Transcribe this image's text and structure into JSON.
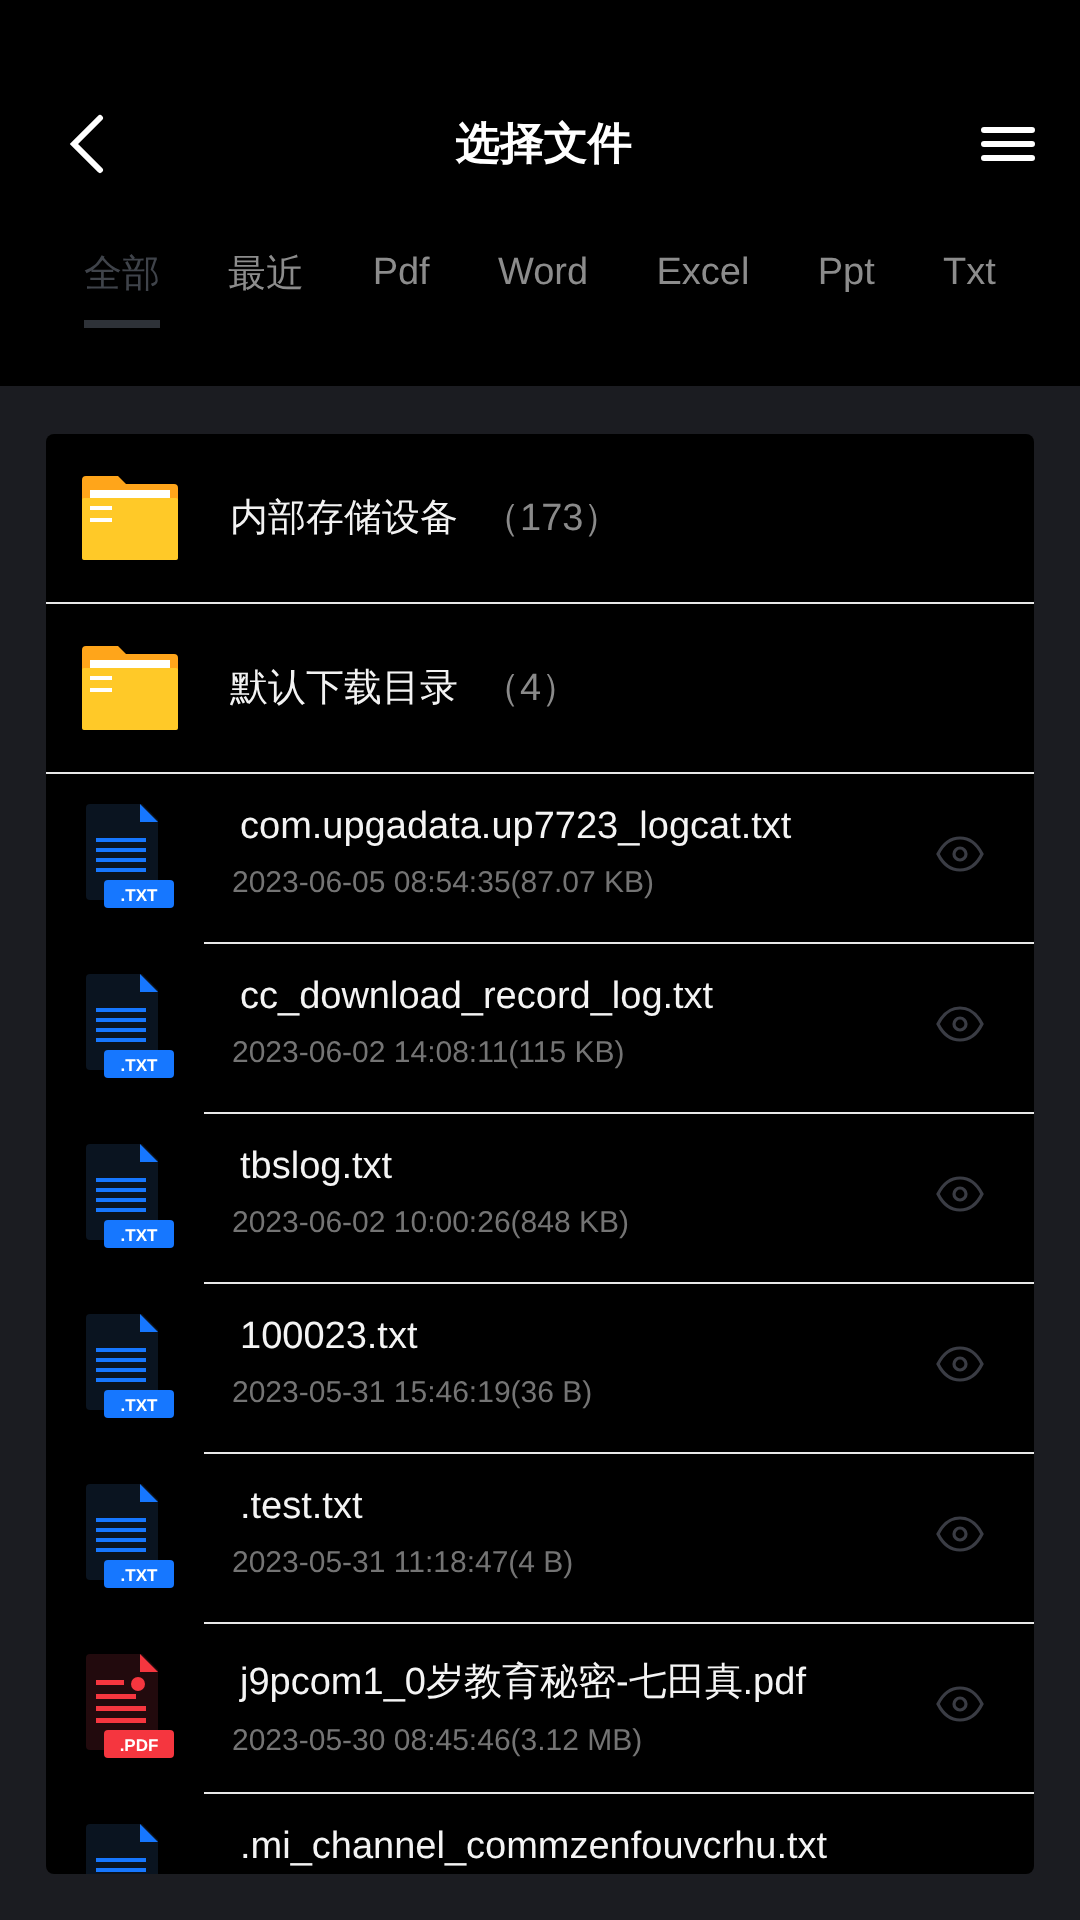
{
  "header": {
    "title": "选择文件"
  },
  "tabs": [
    {
      "label": "全部",
      "selected": true
    },
    {
      "label": "最近",
      "selected": false
    },
    {
      "label": "Pdf",
      "selected": false
    },
    {
      "label": "Word",
      "selected": false
    },
    {
      "label": "Excel",
      "selected": false
    },
    {
      "label": "Ppt",
      "selected": false
    },
    {
      "label": "Txt",
      "selected": false
    }
  ],
  "folders": [
    {
      "name": "内部存储设备",
      "count": "（173）"
    },
    {
      "name": "默认下载目录",
      "count": "（4）"
    }
  ],
  "files": [
    {
      "kind": "txt",
      "badge": ".TXT",
      "name": "com.upgadata.up7723_logcat.txt",
      "details": "2023-06-05 08:54:35(87.07 KB)"
    },
    {
      "kind": "txt",
      "badge": ".TXT",
      "name": "cc_download_record_log.txt",
      "details": "2023-06-02 14:08:11(115 KB)"
    },
    {
      "kind": "txt",
      "badge": ".TXT",
      "name": "tbslog.txt",
      "details": "2023-06-02 10:00:26(848 KB)"
    },
    {
      "kind": "txt",
      "badge": ".TXT",
      "name": "100023.txt",
      "details": "2023-05-31 15:46:19(36 B)"
    },
    {
      "kind": "txt",
      "badge": ".TXT",
      "name": ".test.txt",
      "details": "2023-05-31 11:18:47(4 B)"
    },
    {
      "kind": "pdf",
      "badge": ".PDF",
      "name": "j9pcom1_0岁教育秘密-七田真.pdf",
      "details": "2023-05-30 08:45:46(3.12 MB)"
    },
    {
      "kind": "txt",
      "name": ".mi_channel_commzenfouvcrhu.txt"
    }
  ]
}
